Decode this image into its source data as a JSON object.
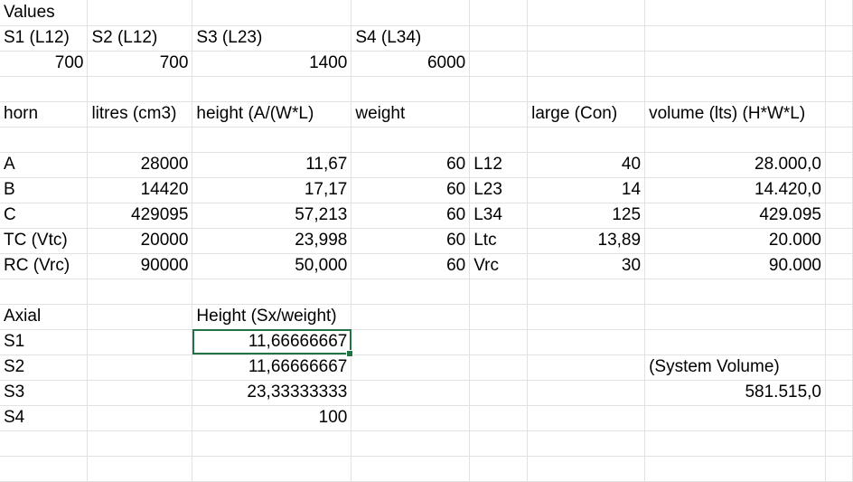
{
  "rows": [
    [
      "Values",
      "",
      "",
      "",
      "",
      "",
      "",
      ""
    ],
    [
      "S1 (L12)",
      "S2 (L12)",
      "S3 (L23)",
      "S4 (L34)",
      "",
      "",
      "",
      ""
    ],
    [
      "700",
      "700",
      "1400",
      "6000",
      "",
      "",
      "",
      ""
    ],
    [
      "",
      "",
      "",
      "",
      "",
      "",
      "",
      ""
    ],
    [
      "horn",
      "litres (cm3)",
      "height (A/(W*L)",
      "weight",
      "",
      "large (Con)",
      "volume (lts) (H*W*L)",
      ""
    ],
    [
      "",
      "",
      "",
      "",
      "",
      "",
      "",
      ""
    ],
    [
      "A",
      "28000",
      "11,67",
      "60",
      "L12",
      "40",
      "28.000,0",
      ""
    ],
    [
      "B",
      "14420",
      "17,17",
      "60",
      "L23",
      "14",
      "14.420,0",
      ""
    ],
    [
      "C",
      "429095",
      "57,213",
      "60",
      "L34",
      "125",
      "429.095",
      ""
    ],
    [
      "TC (Vtc)",
      "20000",
      "23,998",
      "60",
      "Ltc",
      "13,89",
      "20.000",
      ""
    ],
    [
      "RC (Vrc)",
      "90000",
      "50,000",
      "60",
      "Vrc",
      "30",
      "90.000",
      ""
    ],
    [
      "",
      "",
      "",
      "",
      "",
      "",
      "",
      ""
    ],
    [
      "Axial",
      "",
      "Height (Sx/weight)",
      "",
      "",
      "",
      "",
      ""
    ],
    [
      "S1",
      "",
      "11,66666667",
      "",
      "",
      "",
      "",
      ""
    ],
    [
      "S2",
      "",
      "11,66666667",
      "",
      "",
      "",
      "(System Volume)",
      ""
    ],
    [
      "S3",
      "",
      "23,33333333",
      "",
      "",
      "",
      "581.515,0",
      ""
    ],
    [
      "S4",
      "",
      "100",
      "",
      "",
      "",
      "",
      ""
    ],
    [
      "",
      "",
      "",
      "",
      "",
      "",
      "",
      ""
    ],
    [
      "",
      "",
      "",
      "",
      "",
      "",
      "",
      ""
    ]
  ]
}
